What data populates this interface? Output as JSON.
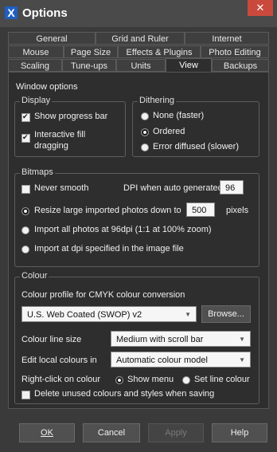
{
  "window": {
    "title": "Options",
    "app_icon": "X",
    "close_icon": "close-icon"
  },
  "tabs": {
    "row1": [
      "General",
      "Grid and Ruler",
      "Internet"
    ],
    "row2": [
      "Mouse",
      "Page Size",
      "Effects & Plugins",
      "Photo Editing"
    ],
    "row3": [
      "Scaling",
      "Tune-ups",
      "Units",
      "View",
      "Backups"
    ],
    "active": "View"
  },
  "window_options": {
    "label": "Window options",
    "display": {
      "label": "Display",
      "show_progress_bar": "Show progress bar",
      "interactive_fill_dragging_1": "Interactive fill",
      "interactive_fill_dragging_2": "dragging"
    },
    "dithering": {
      "label": "Dithering",
      "none": "None (faster)",
      "ordered": "Ordered",
      "error_diffused": "Error diffused (slower)"
    }
  },
  "bitmaps": {
    "label": "Bitmaps",
    "never_smooth": "Never smooth",
    "dpi_label": "DPI when auto generated",
    "dpi_value": "96",
    "resize_label": "Resize large imported photos down to",
    "resize_value": "500",
    "resize_unit": "pixels",
    "import_96": "Import all photos at 96dpi (1:1 at 100% zoom)",
    "import_dpi": "Import at dpi specified in the image file"
  },
  "colour": {
    "label": "Colour",
    "cmyk_label": "Colour profile for CMYK colour conversion",
    "cmyk_value": "U.S. Web Coated (SWOP) v2",
    "browse": "Browse...",
    "line_size_label": "Colour line size",
    "line_size_value": "Medium with scroll bar",
    "edit_local_label": "Edit local colours in",
    "edit_local_value": "Automatic colour model",
    "right_click_label": "Right-click on colour",
    "show_menu": "Show menu",
    "set_line_colour": "Set line colour",
    "delete_unused": "Delete unused colours and styles when saving"
  },
  "buttons": {
    "ok": "OK",
    "cancel": "Cancel",
    "apply": "Apply",
    "help": "Help"
  }
}
